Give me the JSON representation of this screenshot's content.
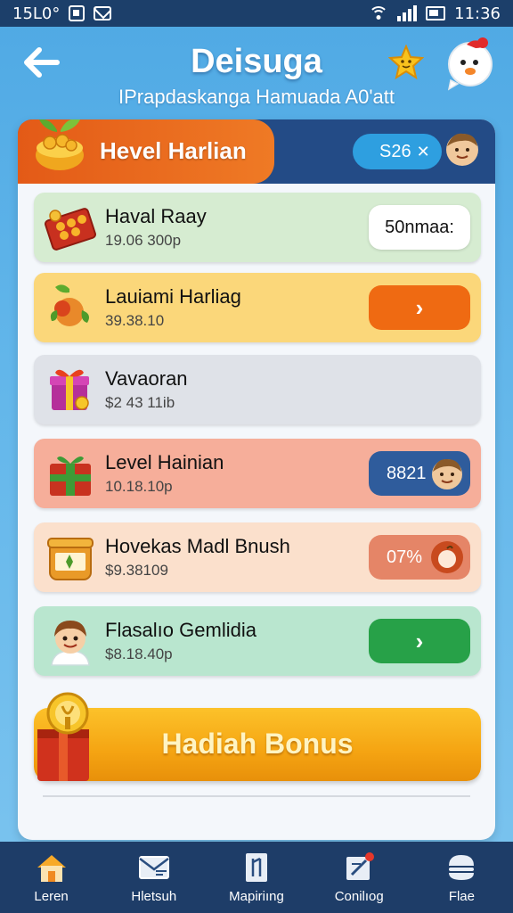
{
  "status_bar": {
    "left_text": "15L0°",
    "time": "11:36"
  },
  "header": {
    "title": "Deisuga",
    "subtitle": "IPrapdaskanga Hamuada A0'att"
  },
  "panel": {
    "title": "Hevel Harlian",
    "balance": "S26"
  },
  "rows": [
    {
      "title": "Haval Raay",
      "sub": "19.06 300p",
      "action": "50nmaa:",
      "color": "#d6ecd1"
    },
    {
      "title": "Lauiami Harliag",
      "sub": "39.38.10",
      "action": "",
      "color": "#fbd77a"
    },
    {
      "title": "Vavaoran",
      "sub": "$2 43 11ib",
      "action": "",
      "color": "#dfe2e8"
    },
    {
      "title": "Level Hainian",
      "sub": "10.18.10p",
      "action": "8821",
      "color": "#f6ae9a"
    },
    {
      "title": "Hovekas Madl Bnush",
      "sub": "$9.38109",
      "action": "07%",
      "color": "#fbe0cc"
    },
    {
      "title": "Flasalıo Gemlidia",
      "sub": "$8.18.40p",
      "action": "",
      "color": "#b9e6cf"
    }
  ],
  "bonus": {
    "label": "Hadiah Bonus"
  },
  "nav": [
    {
      "label": "Leren",
      "icon": "home-icon"
    },
    {
      "label": "Hletsuh",
      "icon": "mail-icon"
    },
    {
      "label": "Mapiriıng",
      "icon": "bookmark-icon"
    },
    {
      "label": "Conilıog",
      "icon": "edit-icon"
    },
    {
      "label": "Flae",
      "icon": "menu-icon"
    }
  ],
  "colors": {
    "orange_button": "#ef6a12",
    "blue_button": "#2f5c9c",
    "green_button": "#27a148",
    "peach_button": "#e58567",
    "gold": "#f7ad18"
  }
}
